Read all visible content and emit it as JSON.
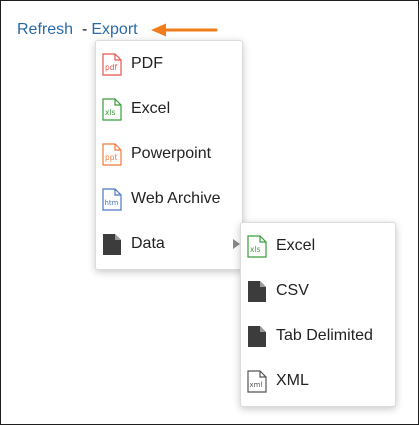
{
  "toolbar": {
    "refresh_label": "Refresh",
    "separator": "-",
    "export_label": "Export"
  },
  "colors": {
    "link": "#2a6aa8",
    "arrow": "#f07c1b",
    "pdf": "#e8554e",
    "xls": "#3a9c3a",
    "ppt": "#ef7a3c",
    "htm": "#4a78c0",
    "doc_dark": "#3c3c3c"
  },
  "export_menu": {
    "items": [
      {
        "label": "PDF",
        "icon": "pdf-file-icon",
        "icon_text": "pdf"
      },
      {
        "label": "Excel",
        "icon": "excel-file-icon",
        "icon_text": "xls"
      },
      {
        "label": "Powerpoint",
        "icon": "powerpoint-file-icon",
        "icon_text": "ppt"
      },
      {
        "label": "Web Archive",
        "icon": "web-archive-file-icon",
        "icon_text": "htm"
      },
      {
        "label": "Data",
        "icon": "data-file-icon",
        "has_submenu": true
      }
    ]
  },
  "data_submenu": {
    "items": [
      {
        "label": "Excel",
        "icon": "excel-file-icon",
        "icon_text": "xls"
      },
      {
        "label": "CSV",
        "icon": "csv-file-icon"
      },
      {
        "label": "Tab Delimited",
        "icon": "tab-delimited-file-icon"
      },
      {
        "label": "XML",
        "icon": "xml-file-icon",
        "icon_text": "xml"
      }
    ]
  }
}
